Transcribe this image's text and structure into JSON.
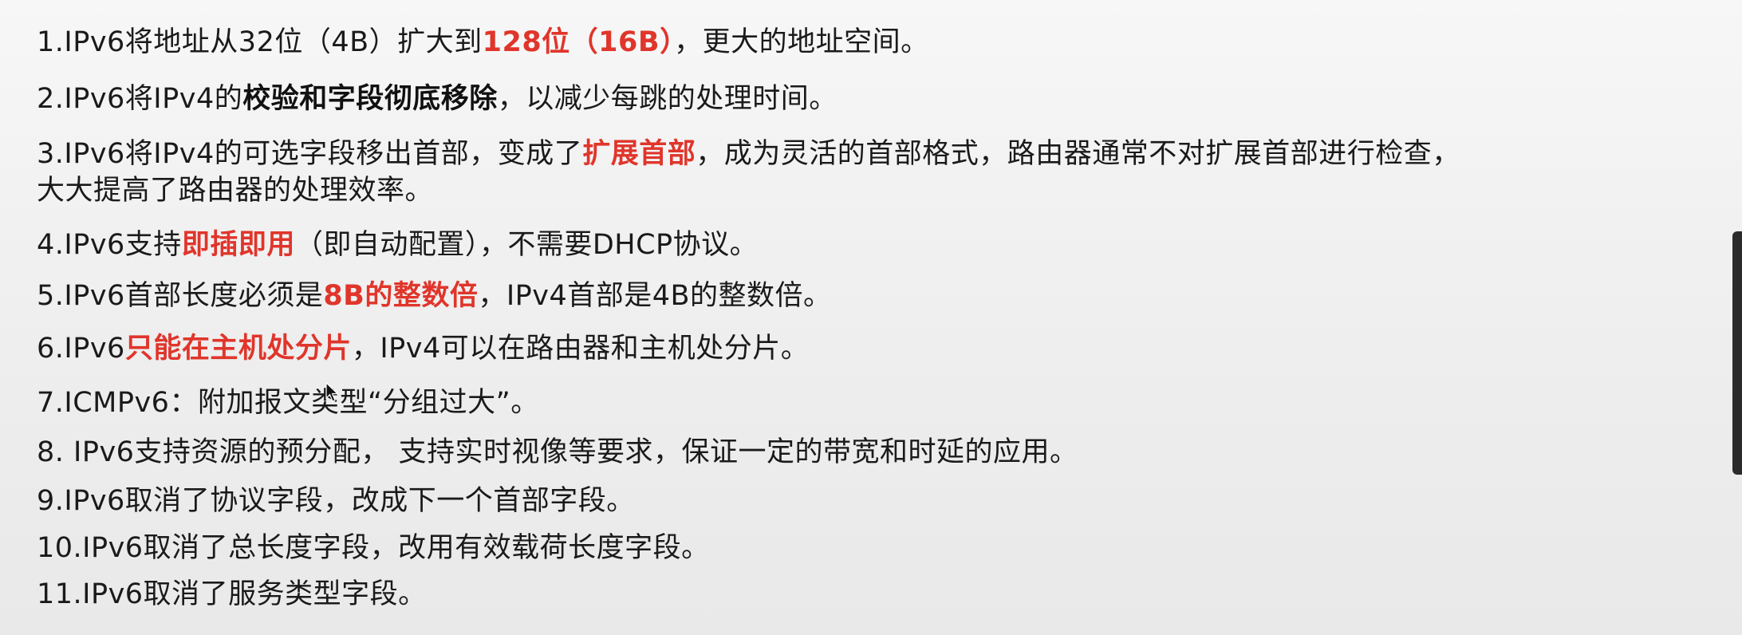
{
  "items": [
    {
      "text_a": "1.IPv6将地址从32位（4B）扩大到",
      "em": "128位（16B）",
      "text_b": "，更大的地址空间。"
    },
    {
      "text_a": "2.IPv6将IPv4的",
      "bold": "校验和字段彻底移除",
      "text_b": "，以减少每跳的处理时间。"
    },
    {
      "text_a": "3.IPv6将IPv4的可选字段移出首部，变成了",
      "em": "扩展首部",
      "text_b": "，成为灵活的首部格式，路由器通常不对扩展首部进行检查，",
      "text_c": "大大提高了路由器的处理效率。"
    },
    {
      "text_a": "4.IPv6支持",
      "em": "即插即用",
      "text_b": "（即自动配置），不需要DHCP协议。"
    },
    {
      "text_a": "5.IPv6首部长度必须是",
      "em": "8B的整数倍",
      "text_b": "，IPv4首部是4B的整数倍。"
    },
    {
      "text_a": "6.IPv6",
      "em": "只能在主机处分片",
      "text_b": "，IPv4可以在路由器和主机处分片。"
    },
    {
      "text_a": "7.ICMPv6：附加报文类型“分组过大”。"
    },
    {
      "text_a": "8. IPv6支持资源的预分配，  支持实时视像等要求，保证一定的带宽和时延的应用。"
    },
    {
      "text_a": "9.IPv6取消了协议字段，改成下一个首部字段。"
    },
    {
      "text_a": "10.IPv6取消了总长度字段，改用有效载荷长度字段。"
    },
    {
      "text_a": "11.IPv6取消了服务类型字段。"
    }
  ],
  "colors": {
    "emphasis": "#e0352b",
    "text": "#1a1a1a",
    "background": "#f1f1f1"
  }
}
